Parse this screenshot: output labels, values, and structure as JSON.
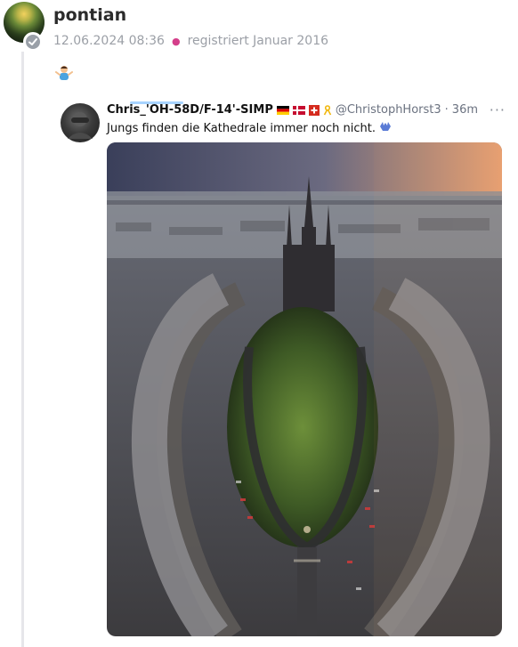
{
  "post": {
    "username": "pontian",
    "timestamp": "12.06.2024 08:36",
    "registered": "registriert Januar 2016"
  },
  "embed": {
    "name": "Chris_'OH-58D/F-14'-SIMP",
    "handle": "@ChristophHorst3",
    "separator": "·",
    "time": "36m",
    "text": "Jungs finden die Kathedrale immer noch nicht.",
    "more": "···"
  }
}
